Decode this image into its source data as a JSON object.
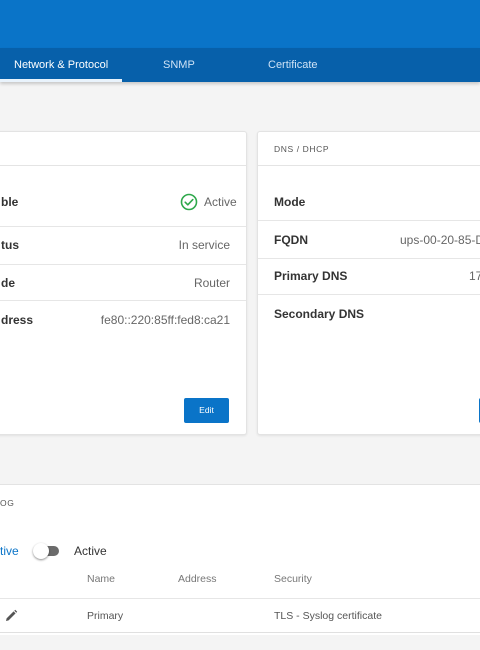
{
  "tabs": [
    {
      "label": "Network & Protocol",
      "active": true
    },
    {
      "label": "SNMP",
      "active": false
    },
    {
      "label": "Certificate",
      "active": false
    }
  ],
  "left_card": {
    "rows": [
      {
        "label": "ble",
        "value": "Active",
        "icon": "check-circle-icon"
      },
      {
        "label": "tus",
        "value": "In service"
      },
      {
        "label": "de",
        "value": "Router"
      },
      {
        "label": "dress",
        "value": "fe80::220:85ff:fed8:ca21"
      }
    ],
    "edit_label": "Edit"
  },
  "dns_card": {
    "title": "DNS / DHCP",
    "rows": [
      {
        "label": "Mode",
        "value": ""
      },
      {
        "label": "FQDN",
        "value": "ups-00-20-85-D"
      },
      {
        "label": "Primary DNS",
        "value": "17"
      },
      {
        "label": "Secondary DNS",
        "value": ""
      }
    ]
  },
  "syslog": {
    "title": "OG",
    "active_partial": "tive",
    "toggle_label": "Active",
    "columns": [
      "Name",
      "Address",
      "Security"
    ],
    "rows": [
      {
        "name": "Primary",
        "address": "",
        "security": "TLS - Syslog certificate"
      }
    ]
  },
  "colors": {
    "brand": "#0a74c8",
    "success": "#2ea84b"
  }
}
